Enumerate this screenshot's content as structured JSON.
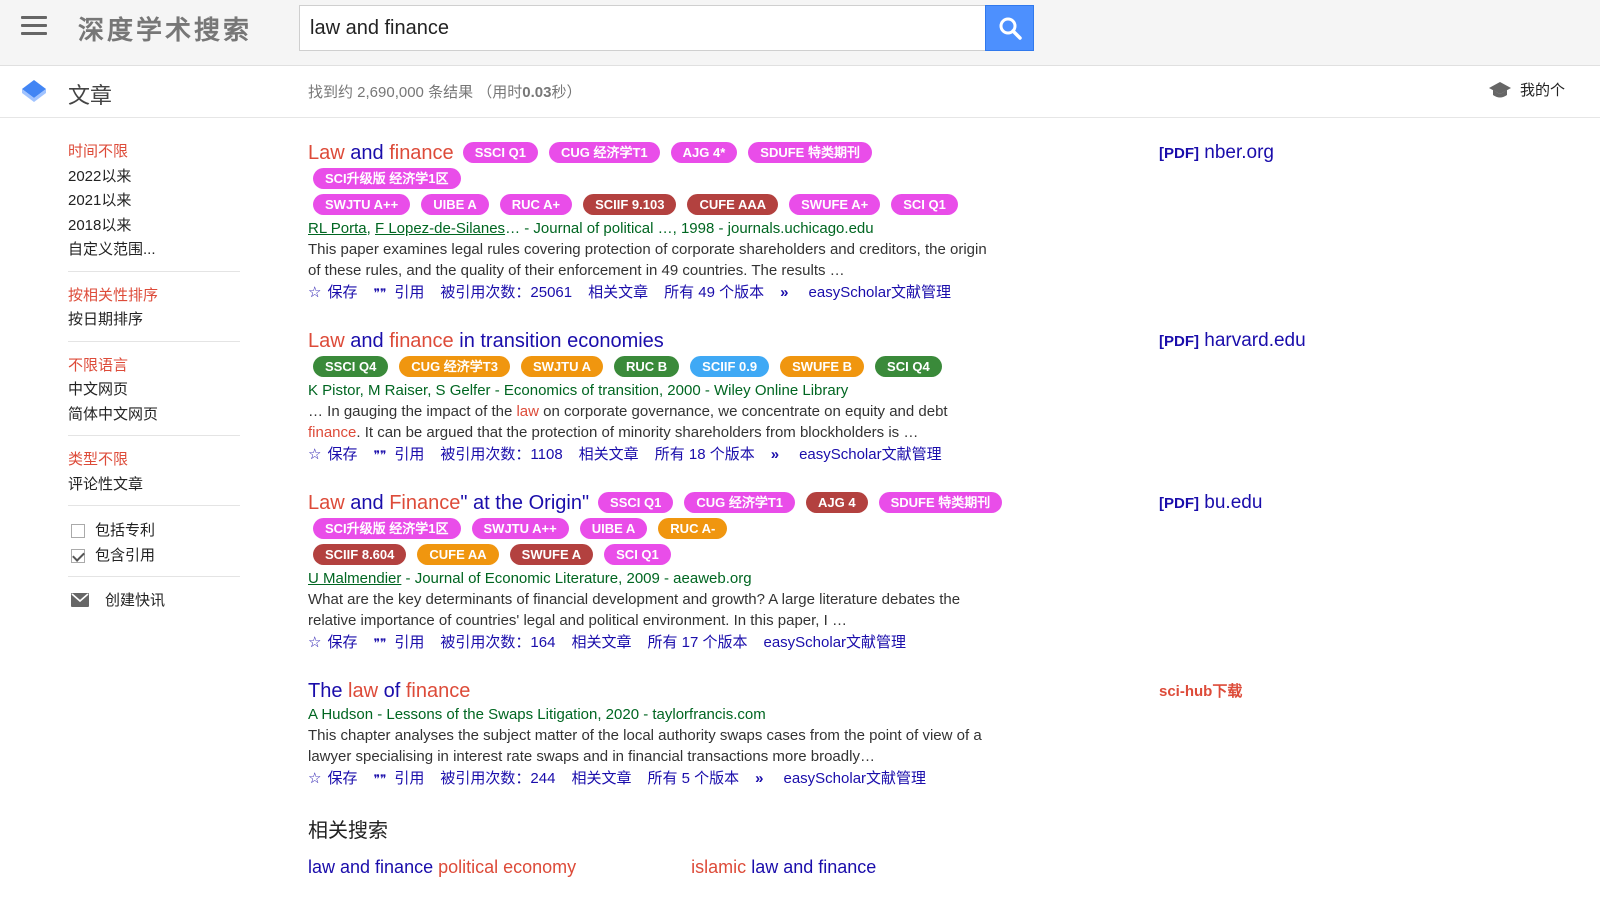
{
  "header": {
    "logo": "深度学术搜索",
    "search_value": "law and finance"
  },
  "subbar": {
    "section": "文章",
    "stats_prefix": "找到约 2,690,000 条结果 （用时",
    "stats_time": "0.03",
    "stats_suffix": "秒）",
    "mine": "我的个"
  },
  "sidebar": {
    "time": [
      "时间不限",
      "2022以来",
      "2021以来",
      "2018以来",
      "自定义范围..."
    ],
    "sort": [
      "按相关性排序",
      "按日期排序"
    ],
    "lang": [
      "不限语言",
      "中文网页",
      "简体中文网页"
    ],
    "type": [
      "类型不限",
      "评论性文章"
    ],
    "include_patents": "包括专利",
    "include_citations": "包含引用",
    "create_alert": "创建快讯"
  },
  "results": [
    {
      "title_parts": [
        [
          "Law",
          true
        ],
        [
          " and ",
          false
        ],
        [
          "finance",
          true
        ]
      ],
      "badge_rows": [
        [
          [
            "SSCI Q1",
            "#e94de9"
          ],
          [
            "CUG 经济学T1",
            "#e94de9"
          ],
          [
            "AJG 4*",
            "#e94de9"
          ],
          [
            "SDUFE 特类期刊",
            "#e94de9"
          ]
        ],
        [
          [
            "SCI升级版 经济学1区",
            "#e94de9"
          ]
        ],
        [
          [
            "SWJTU A++",
            "#e94de9"
          ],
          [
            "UIBE A",
            "#e94de9"
          ],
          [
            "RUC A+",
            "#e94de9"
          ],
          [
            "SCIIF 9.103",
            "#b3413f"
          ],
          [
            "CUFE AAA",
            "#b3413f"
          ],
          [
            "SWUFE A+",
            "#e94de9"
          ],
          [
            "SCI Q1",
            "#e94de9"
          ]
        ]
      ],
      "badges_inline_first": true,
      "authors": [
        "RL Porta",
        "F Lopez-de-Silanes"
      ],
      "meta_rest": "… - Journal of political …, 1998 - journals.uchicago.edu",
      "snippet_parts": [
        [
          "This paper examines legal rules covering protection of corporate shareholders and creditors, the origin of these rules, and the quality of their enforcement in 49 countries. The results …",
          false
        ]
      ],
      "save": "保存",
      "cite": "引用",
      "cited_by": "被引用次数：25061",
      "related": "相关文章",
      "versions": "所有 49 个版本",
      "easyscholar": "easyScholar文献管理",
      "right_pdf": "[PDF]",
      "right_site": "nber.org"
    },
    {
      "title_parts": [
        [
          "Law",
          true
        ],
        [
          " and ",
          false
        ],
        [
          "finance",
          true
        ],
        [
          " in transition economies",
          false
        ]
      ],
      "badge_rows": [
        [
          [
            "SSCI Q4",
            "#3a8a3a"
          ],
          [
            "CUG 经济学T3",
            "#f0960f"
          ],
          [
            "SWJTU A",
            "#f0960f"
          ],
          [
            "RUC B",
            "#3a8a3a"
          ],
          [
            "SCIIF 0.9",
            "#3fa9f5"
          ],
          [
            "SWUFE B",
            "#f0960f"
          ],
          [
            "SCI Q4",
            "#3a8a3a"
          ]
        ]
      ],
      "badges_inline_first": false,
      "authors": [],
      "meta_rest": "K Pistor, M Raiser, S Gelfer - Economics of transition, 2000 - Wiley Online Library",
      "snippet_parts": [
        [
          "… In gauging the impact of the ",
          false
        ],
        [
          "law",
          true
        ],
        [
          " on corporate governance, we concentrate on equity and debt ",
          false
        ],
        [
          "finance",
          true
        ],
        [
          ". It can be argued that the protection of minority shareholders from blockholders is …",
          false
        ]
      ],
      "save": "保存",
      "cite": "引用",
      "cited_by": "被引用次数：1108",
      "related": "相关文章",
      "versions": "所有 18 个版本",
      "easyscholar": "easyScholar文献管理",
      "right_pdf": "[PDF]",
      "right_site": "harvard.edu"
    },
    {
      "title_parts": [
        [
          "Law",
          true
        ],
        [
          " and ",
          false
        ],
        [
          "Finance",
          true
        ],
        [
          "\" at the Origin\"",
          false
        ]
      ],
      "badge_rows": [
        [
          [
            "SSCI Q1",
            "#e94de9"
          ],
          [
            "CUG 经济学T1",
            "#e94de9"
          ],
          [
            "AJG 4",
            "#b3413f"
          ],
          [
            "SDUFE 特类期刊",
            "#e94de9"
          ]
        ],
        [
          [
            "SCI升级版 经济学1区",
            "#e94de9"
          ],
          [
            "SWJTU A++",
            "#e94de9"
          ],
          [
            "UIBE A",
            "#e94de9"
          ],
          [
            "RUC A-",
            "#f0960f"
          ]
        ],
        [
          [
            "SCIIF 8.604",
            "#b3413f"
          ],
          [
            "CUFE AA",
            "#f0960f"
          ],
          [
            "SWUFE A",
            "#b3413f"
          ],
          [
            "SCI Q1",
            "#e94de9"
          ]
        ]
      ],
      "badges_inline_first": true,
      "authors": [
        "U Malmendier"
      ],
      "meta_rest": " - Journal of Economic Literature, 2009 - aeaweb.org",
      "snippet_parts": [
        [
          "What are the key determinants of financial development and growth? A large literature debates the relative importance of countries' legal and political environment. In this paper, I …",
          false
        ]
      ],
      "save": "保存",
      "cite": "引用",
      "cited_by": "被引用次数：164",
      "related": "相关文章",
      "versions": "所有 17 个版本",
      "easyscholar": "easyScholar文献管理",
      "right_pdf": "[PDF]",
      "right_site": "bu.edu"
    },
    {
      "title_parts": [
        [
          "The ",
          false
        ],
        [
          "law",
          true
        ],
        [
          " of ",
          false
        ],
        [
          "finance",
          true
        ]
      ],
      "badge_rows": [],
      "badges_inline_first": false,
      "authors": [],
      "meta_rest": "A Hudson - Lessons of the Swaps Litigation, 2020 - taylorfrancis.com",
      "snippet_parts": [
        [
          "This chapter analyses the subject matter of the local authority swaps cases from the point of view of a lawyer specialising in interest rate swaps and in financial transactions more broadly…",
          false
        ]
      ],
      "save": "保存",
      "cite": "引用",
      "cited_by": "被引用次数：244",
      "related": "相关文章",
      "versions": "所有 5 个版本",
      "easyscholar": "easyScholar文献管理",
      "right_scihub": "sci-hub下载"
    }
  ],
  "related_searches": {
    "title": "相关搜索",
    "links": [
      [
        [
          "law and finance ",
          false
        ],
        [
          "political economy",
          true
        ]
      ],
      [
        [
          "islamic",
          true
        ],
        [
          " law and finance",
          false
        ]
      ]
    ]
  },
  "colors": {
    "accent": "#dd4b39",
    "link": "#1a0dab",
    "meta": "#006621",
    "search_button": "#4d90fe"
  }
}
